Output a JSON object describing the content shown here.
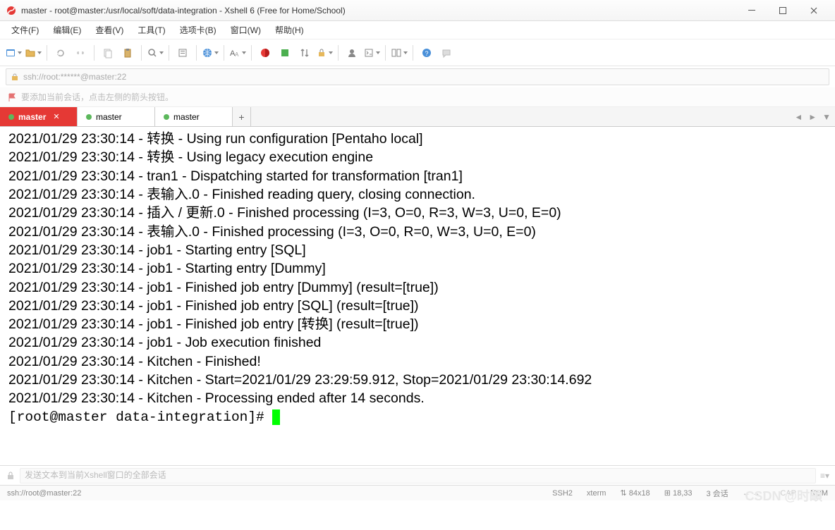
{
  "window": {
    "title": "master - root@master:/usr/local/soft/data-integration - Xshell 6 (Free for Home/School)"
  },
  "menu": {
    "file": "文件(F)",
    "edit": "编辑(E)",
    "view": "查看(V)",
    "tools": "工具(T)",
    "tabs": "选项卡(B)",
    "window": "窗口(W)",
    "help": "帮助(H)"
  },
  "address": {
    "value": "ssh://root:******@master:22"
  },
  "hint": "要添加当前会话，点击左侧的箭头按钮。",
  "tabs": [
    {
      "label": "master",
      "active": true
    },
    {
      "label": "master",
      "active": false
    },
    {
      "label": "master",
      "active": false
    }
  ],
  "terminal_lines": [
    "2021/01/29 23:30:14 - 转换 - Using run configuration [Pentaho local]",
    "2021/01/29 23:30:14 - 转换 - Using legacy execution engine",
    "2021/01/29 23:30:14 - tran1 - Dispatching started for transformation [tran1]",
    "2021/01/29 23:30:14 - 表输入.0 - Finished reading query, closing connection.",
    "2021/01/29 23:30:14 - 插入 / 更新.0 - Finished processing (I=3, O=0, R=3, W=3, U=0, E=0)",
    "2021/01/29 23:30:14 - 表输入.0 - Finished processing (I=3, O=0, R=0, W=3, U=0, E=0)",
    "2021/01/29 23:30:14 - job1 - Starting entry [SQL]",
    "2021/01/29 23:30:14 - job1 - Starting entry [Dummy]",
    "2021/01/29 23:30:14 - job1 - Finished job entry [Dummy] (result=[true])",
    "2021/01/29 23:30:14 - job1 - Finished job entry [SQL] (result=[true])",
    "2021/01/29 23:30:14 - job1 - Finished job entry [转换] (result=[true])",
    "2021/01/29 23:30:14 - job1 - Job execution finished",
    "2021/01/29 23:30:14 - Kitchen - Finished!",
    "2021/01/29 23:30:14 - Kitchen - Start=2021/01/29 23:29:59.912, Stop=2021/01/29 23:30:14.692",
    "2021/01/29 23:30:14 - Kitchen - Processing ended after 14 seconds."
  ],
  "prompt": "[root@master data-integration]# ",
  "sendbar_placeholder": "发送文本到当前Xshell窗口的全部会话",
  "status": {
    "addr": "ssh://root@master:22",
    "proto": "SSH2",
    "term": "xterm",
    "size_icon": "⇅",
    "size": "84x18",
    "cursor_icon": "⊞",
    "cursor": "18,33",
    "sessions": "3 会话",
    "caps": "CAP",
    "num": "NUM"
  },
  "watermark": "CSDN @时頔"
}
